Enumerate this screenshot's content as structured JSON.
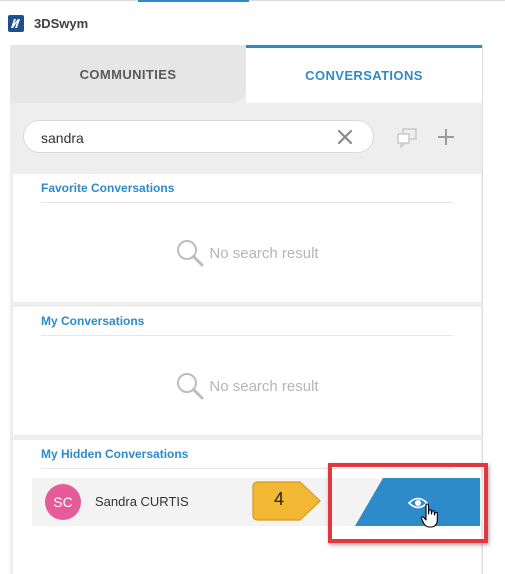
{
  "app": {
    "title": "3DSwym"
  },
  "tabs": [
    {
      "label": "COMMUNITIES",
      "active": false
    },
    {
      "label": "CONVERSATIONS",
      "active": true
    }
  ],
  "search": {
    "value": "sandra",
    "placeholder": ""
  },
  "icons": {
    "app_logo": "3ds-logo-icon",
    "clear": "close-icon",
    "new_group": "new-group-conversation-icon",
    "add": "plus-icon",
    "empty": "search-icon",
    "unhide": "eye-icon",
    "cursor": "hand-pointer-icon"
  },
  "sections": [
    {
      "title": "Favorite Conversations",
      "empty_text": "No search result"
    },
    {
      "title": "My Conversations",
      "empty_text": "No search result"
    },
    {
      "title": "My Hidden Conversations",
      "items": [
        {
          "initials": "SC",
          "name": "Sandra CURTIS"
        }
      ]
    }
  ],
  "callout": {
    "step": "4"
  },
  "colors": {
    "accent": "#2e8bc9",
    "avatar": "#e65b9a",
    "highlight": "#e0383d",
    "badge": "#f2b834"
  }
}
